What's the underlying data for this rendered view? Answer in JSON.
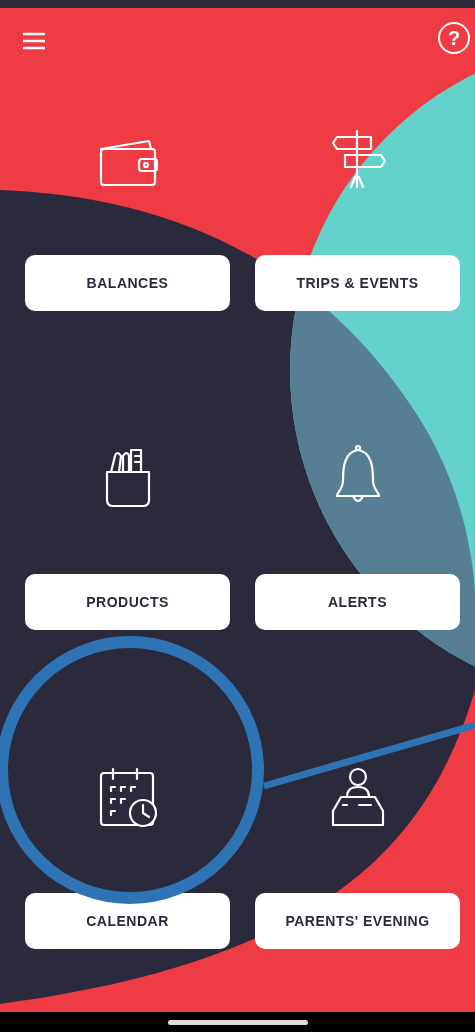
{
  "header": {
    "help": "?"
  },
  "tiles": [
    {
      "label": "BALANCES"
    },
    {
      "label": "TRIPS & EVENTS"
    },
    {
      "label": "PRODUCTS"
    },
    {
      "label": "ALERTS"
    },
    {
      "label": "CALENDAR"
    },
    {
      "label": "PARENTS' EVENING"
    }
  ]
}
